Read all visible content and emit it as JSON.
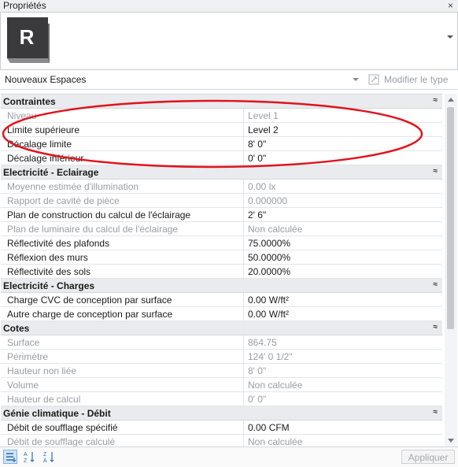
{
  "window": {
    "title": "Propriétés",
    "close_glyph": "×"
  },
  "type_selector": {
    "logo_letter": "R"
  },
  "instance": {
    "selected": "Nouveaux Espaces",
    "edit_type_label": "Modifier le type"
  },
  "groups": [
    {
      "name": "Contraintes",
      "rows": [
        {
          "label": "Niveau",
          "value": "Level 1",
          "dim": true
        },
        {
          "label": "Limite supérieure",
          "value": "Level 2",
          "dim": false
        },
        {
          "label": "Décalage limite",
          "value": "8'  0\"",
          "dim": false
        },
        {
          "label": "Décalage inférieur",
          "value": "0'  0\"",
          "dim": false
        }
      ]
    },
    {
      "name": "Electricité - Eclairage",
      "rows": [
        {
          "label": "Moyenne estimée d'illumination",
          "value": "0.00 lx",
          "dim": true
        },
        {
          "label": "Rapport de cavité de pièce",
          "value": "0.000000",
          "dim": true
        },
        {
          "label": "Plan de construction du calcul de l'éclairage",
          "value": "2'  6\"",
          "dim": false
        },
        {
          "label": "Plan de luminaire du calcul de l'éclairage",
          "value": "Non calculée",
          "dim": true
        },
        {
          "label": "Réflectivité des plafonds",
          "value": "75.0000%",
          "dim": false
        },
        {
          "label": "Réflexion des murs",
          "value": "50.0000%",
          "dim": false
        },
        {
          "label": "Réflectivité des sols",
          "value": "20.0000%",
          "dim": false
        }
      ]
    },
    {
      "name": "Electricité - Charges",
      "rows": [
        {
          "label": "Charge CVC de conception par surface",
          "value": "0.00 W/ft²",
          "dim": false
        },
        {
          "label": "Autre charge de conception par surface",
          "value": "0.00 W/ft²",
          "dim": false
        }
      ]
    },
    {
      "name": "Cotes",
      "rows": [
        {
          "label": "Surface",
          "value": "864.75",
          "dim": true
        },
        {
          "label": "Périmètre",
          "value": "124'  0 1/2\"",
          "dim": true
        },
        {
          "label": "Hauteur non liée",
          "value": "8'  0\"",
          "dim": true
        },
        {
          "label": "Volume",
          "value": "Non calculée",
          "dim": true
        },
        {
          "label": "Hauteur de calcul",
          "value": "0'  0\"",
          "dim": true
        }
      ]
    },
    {
      "name": "Génie climatique - Débit",
      "rows": [
        {
          "label": "Débit de soufflage spécifié",
          "value": "0.00 CFM",
          "dim": false
        },
        {
          "label": "Débit de soufflage calculé",
          "value": "Non calculée",
          "dim": true
        }
      ]
    }
  ],
  "collapse_glyph": "≈",
  "footer": {
    "apply_label": "Appliquer"
  },
  "colors": {
    "annotation": "#e0141e",
    "group_bg": "#e9ebee",
    "logo_bg": "#3a3a3c"
  }
}
